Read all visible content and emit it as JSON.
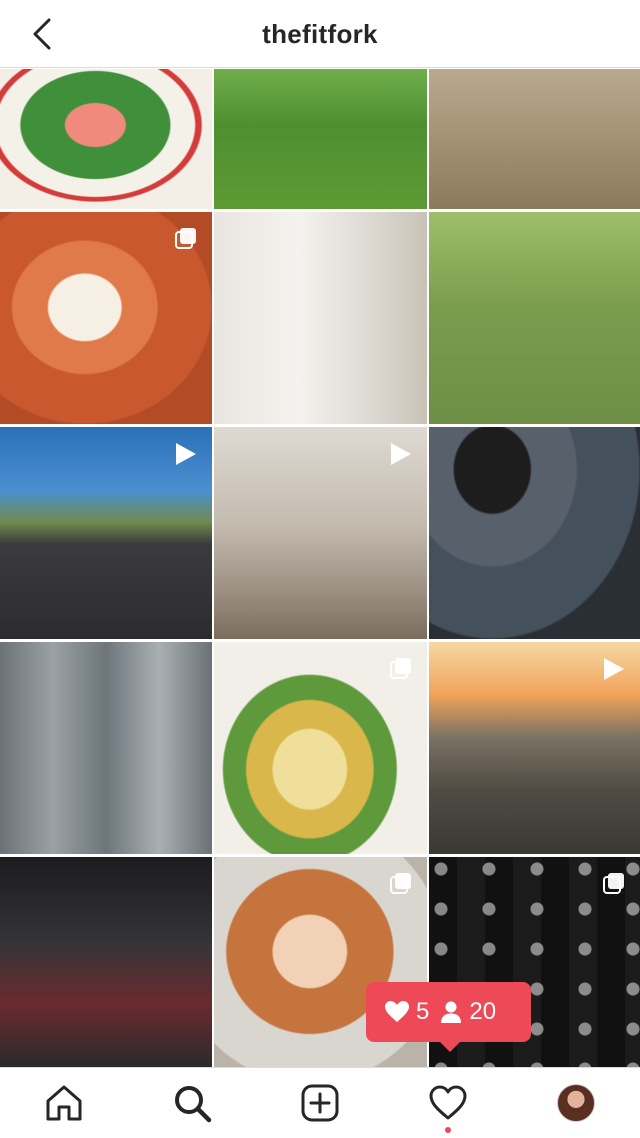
{
  "header": {
    "title": "thefitfork"
  },
  "grid": {
    "posts": [
      {
        "type": "image"
      },
      {
        "type": "image"
      },
      {
        "type": "image"
      },
      {
        "type": "carousel"
      },
      {
        "type": "image"
      },
      {
        "type": "image"
      },
      {
        "type": "video"
      },
      {
        "type": "video"
      },
      {
        "type": "image"
      },
      {
        "type": "image"
      },
      {
        "type": "carousel"
      },
      {
        "type": "video"
      },
      {
        "type": "image"
      },
      {
        "type": "carousel"
      },
      {
        "type": "carousel"
      }
    ]
  },
  "notification": {
    "likes": "5",
    "followers": "20",
    "color": "#ed4956"
  },
  "tabbar": {
    "items": [
      "home-icon",
      "search-icon",
      "add-post-icon",
      "heart-icon",
      "profile-avatar"
    ]
  }
}
